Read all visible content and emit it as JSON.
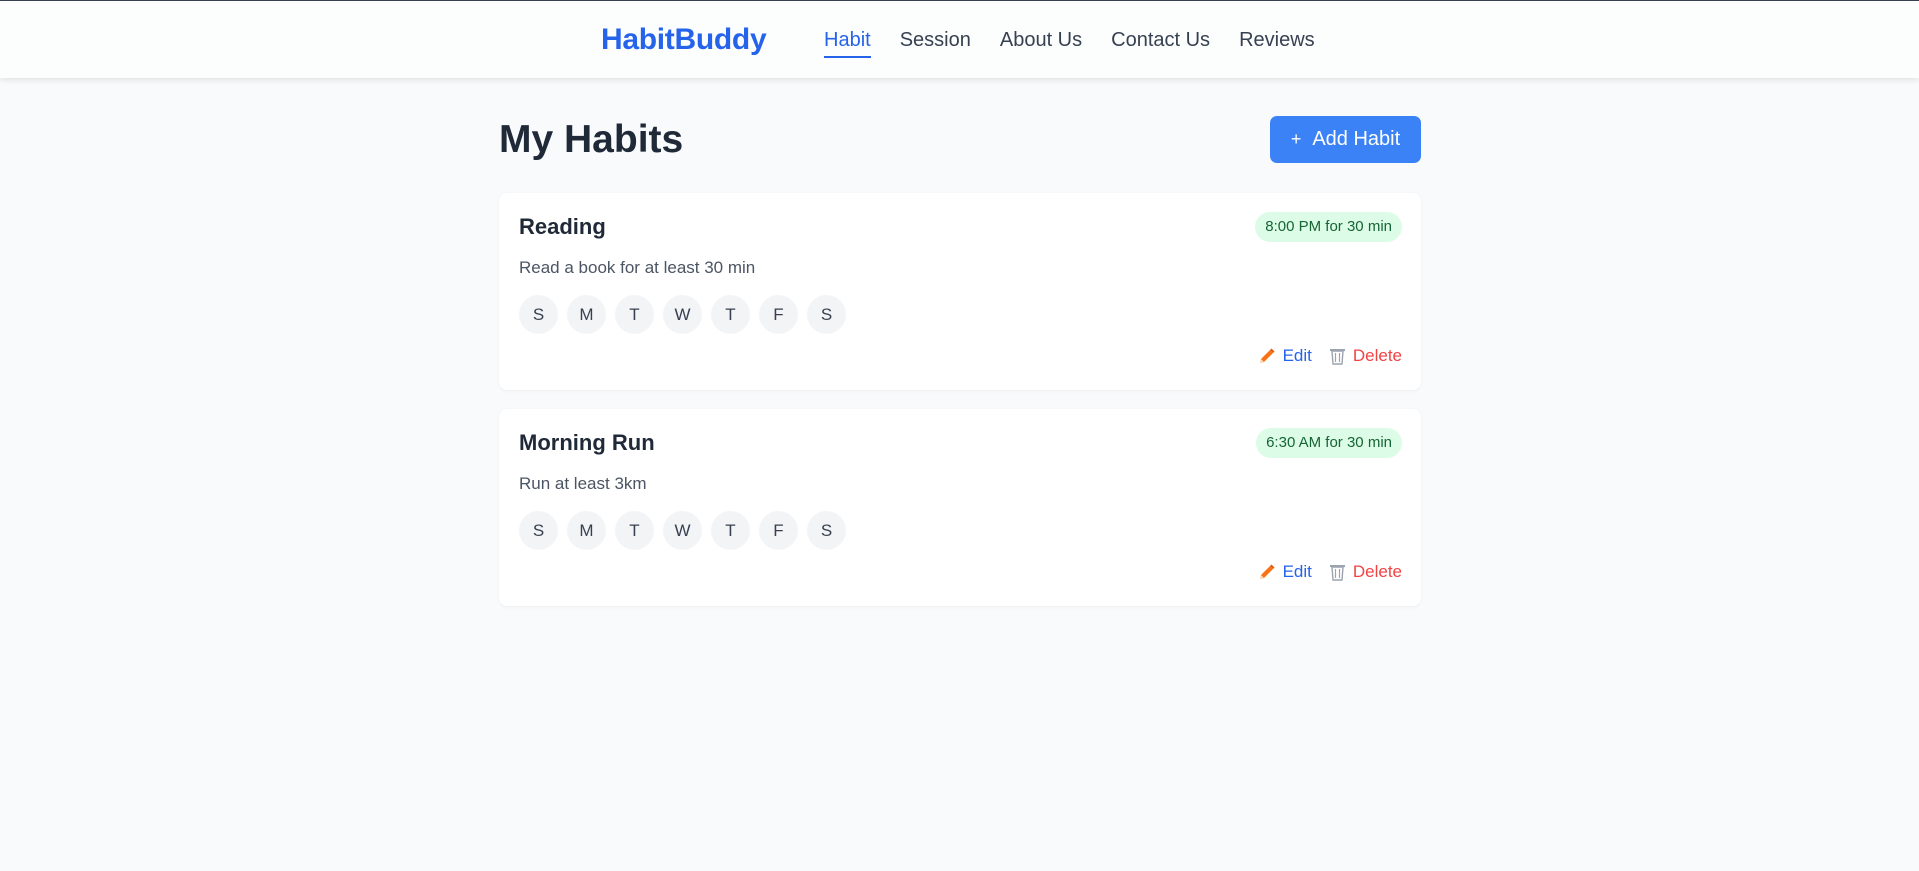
{
  "nav": {
    "brand": "HabitBuddy",
    "links": [
      "Habit",
      "Session",
      "About Us",
      "Contact Us",
      "Reviews"
    ],
    "active": "Habit"
  },
  "page": {
    "title": "My Habits",
    "add_button_label": "Add Habit",
    "add_button_icon": "+"
  },
  "habits": [
    {
      "title": "Reading",
      "schedule": "8:00 PM for 30 min",
      "description": "Read a book for at least 30 min",
      "days": [
        "S",
        "M",
        "T",
        "W",
        "T",
        "F",
        "S"
      ],
      "edit_label": "Edit",
      "delete_label": "Delete"
    },
    {
      "title": "Morning Run",
      "schedule": "6:30 AM for 30 min",
      "description": "Run at least 3km",
      "days": [
        "S",
        "M",
        "T",
        "W",
        "T",
        "F",
        "S"
      ],
      "edit_label": "Edit",
      "delete_label": "Delete"
    }
  ],
  "icons": {
    "edit": "pencil-icon",
    "delete": "trash-icon",
    "add": "plus-icon"
  },
  "colors": {
    "brand": "#2563eb",
    "primary_button": "#3b82f6",
    "badge_bg": "#dcfce7",
    "badge_text": "#166534",
    "delete": "#ef4444"
  }
}
